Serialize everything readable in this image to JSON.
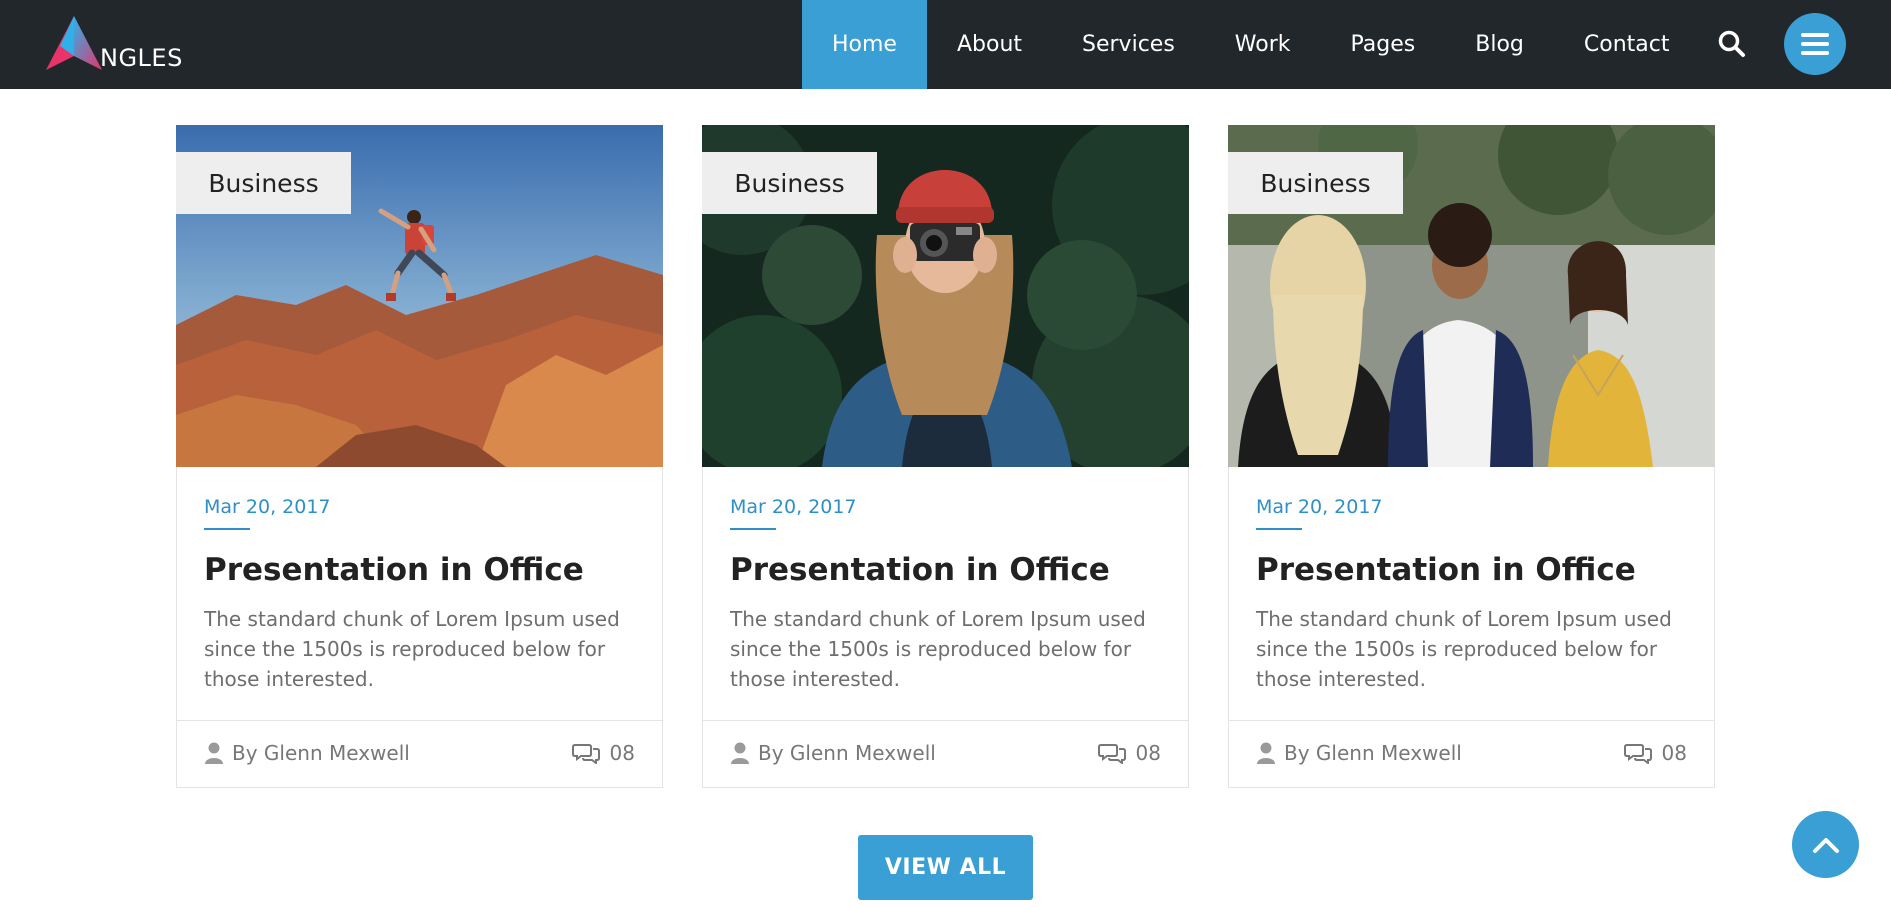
{
  "brand": {
    "logo_text": "NGLES"
  },
  "nav": {
    "items": [
      "Home",
      "About",
      "Services",
      "Work",
      "Pages",
      "Blog",
      "Contact"
    ]
  },
  "icons": {
    "search": "search-icon",
    "menu": "hamburger-menu-icon",
    "author": "user-icon",
    "comments": "comments-icon",
    "scroll_top": "chevron-up-icon"
  },
  "colors": {
    "header_bg": "#22272b",
    "accent": "#3a9fd4",
    "date": "#2f8fc6"
  },
  "cards": [
    {
      "category": "Business",
      "image": "hiker-jumping-on-red-rocks",
      "date": "Mar 20, 2017",
      "title": "Presentation in Office",
      "excerpt": "The standard chunk of Lorem Ipsum used since the 1500s is reproduced below for those interested.",
      "author": "By Glenn Mexwell",
      "comments": "08"
    },
    {
      "category": "Business",
      "image": "woman-with-camera-in-forest",
      "date": "Mar 20, 2017",
      "title": "Presentation in Office",
      "excerpt": "The standard chunk of Lorem Ipsum used since the 1500s is reproduced below for those interested.",
      "author": "By Glenn Mexwell",
      "comments": "08"
    },
    {
      "category": "Business",
      "image": "three-friends-talking-outdoors",
      "date": "Mar 20, 2017",
      "title": "Presentation in Office",
      "excerpt": "The standard chunk of Lorem Ipsum used since the 1500s is reproduced below for those interested.",
      "author": "By Glenn Mexwell",
      "comments": "08"
    }
  ],
  "view_all_label": "VIEW ALL"
}
